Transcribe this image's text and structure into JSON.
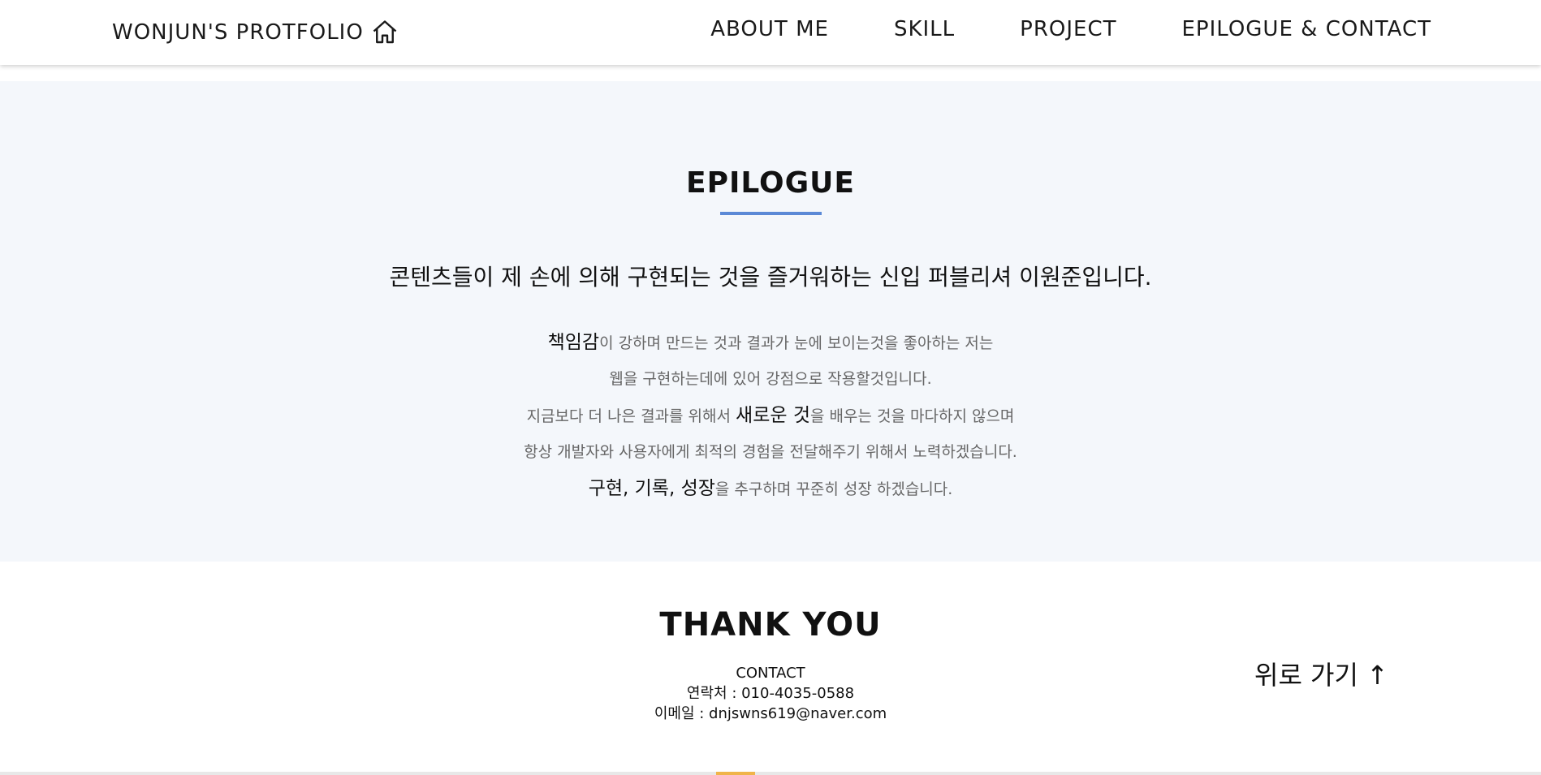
{
  "header": {
    "logo_text": "WONJUN'S PROTFOLIO",
    "logo_icon": "home-icon",
    "nav": [
      {
        "label": "ABOUT ME"
      },
      {
        "label": "SKILL"
      },
      {
        "label": "PROJECT"
      },
      {
        "label": "EPILOGUE & CONTACT"
      }
    ]
  },
  "epilogue": {
    "title": "EPILOGUE",
    "lead": "콘텐츠들이 제 손에 의해 구현되는 것을 즐거워하는 신입 퍼블리셔 이원준입니다.",
    "lines": [
      {
        "em": "책임감",
        "rest": "이 강하며 만드는 것과 결과가 눈에 보이는것을 좋아하는 저는"
      },
      {
        "text": "웹을 구현하는데에 있어 강점으로 작용할것입니다."
      },
      {
        "pre": "지금보다 더 나은 결과를 위해서 ",
        "em": "새로운 것",
        "rest": "을 배우는 것을 마다하지 않으며"
      },
      {
        "text": "항상 개발자와 사용자에게 최적의 경험을 전달해주기 위해서 노력하겠습니다."
      },
      {
        "em": "구현, 기록, 성장",
        "rest": "을 추구하며 꾸준히 성장 하겠습니다."
      }
    ],
    "accent_color": "#5b89d6",
    "background_color": "#f4f7fb"
  },
  "footer": {
    "thanks": "THANK YOU",
    "contact_label": "CONTACT",
    "phone": "연락처 : 010-4035-0588",
    "email": "이메일 : dnjswns619@naver.com",
    "to_top": "위로 가기 ↑"
  }
}
